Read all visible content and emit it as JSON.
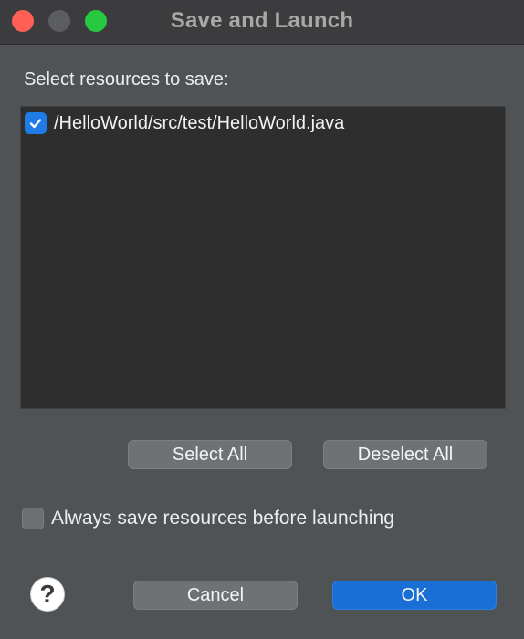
{
  "window": {
    "title": "Save and Launch",
    "traffic_lights": {
      "close_color": "#ff5f57",
      "minimize_color": "#5c5d60",
      "zoom_color": "#28c840"
    }
  },
  "prompt": "Select resources to save:",
  "resources": [
    {
      "label": "/HelloWorld/src/test/HelloWorld.java",
      "checked": true
    }
  ],
  "buttons": {
    "select_all": "Select All",
    "deselect_all": "Deselect All",
    "cancel": "Cancel",
    "ok": "OK"
  },
  "always_save": {
    "label": "Always save resources before launching",
    "checked": false
  },
  "help": {
    "icon": "question-mark-icon",
    "glyph": "?"
  },
  "colors": {
    "accent": "#1a6fd6",
    "window_bg": "#4f5355",
    "list_bg": "#2e2e2e"
  }
}
